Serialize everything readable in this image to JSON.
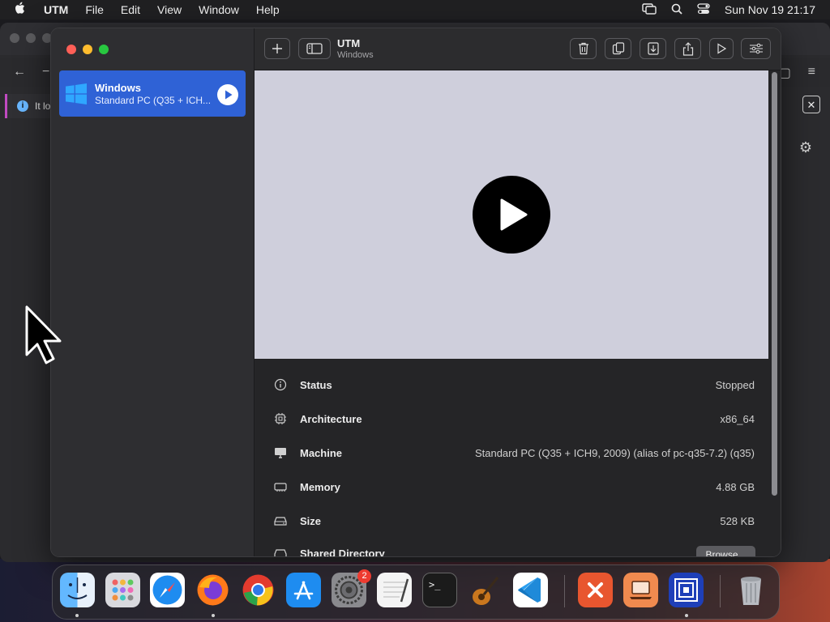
{
  "menubar": {
    "app": "UTM",
    "items": [
      "File",
      "Edit",
      "View",
      "Window",
      "Help"
    ],
    "datetime": "Sun Nov 19 21:17"
  },
  "background_window": {
    "info_text": "It lo"
  },
  "sidebar": {
    "vm": {
      "name": "Windows",
      "subtitle": "Standard PC (Q35 + ICH..."
    }
  },
  "toolbar": {
    "title": "UTM",
    "subtitle": "Windows"
  },
  "details": [
    {
      "label": "Status",
      "value": "Stopped",
      "icon": "info-icon"
    },
    {
      "label": "Architecture",
      "value": "x86_64",
      "icon": "cpu-icon"
    },
    {
      "label": "Machine",
      "value": "Standard PC (Q35 + ICH9, 2009) (alias of pc-q35-7.2) (q35)",
      "icon": "display-icon"
    },
    {
      "label": "Memory",
      "value": "4.88 GB",
      "icon": "memory-icon"
    },
    {
      "label": "Size",
      "value": "528 KB",
      "icon": "drive-icon"
    },
    {
      "label": "Shared Directory",
      "value": "",
      "icon": "folder-icon"
    }
  ],
  "browse_label": "Browse...",
  "dock": {
    "badge_settings": "2"
  },
  "colors": {
    "accent": "#2f62d6",
    "preview_bg": "#cfcfdc"
  }
}
